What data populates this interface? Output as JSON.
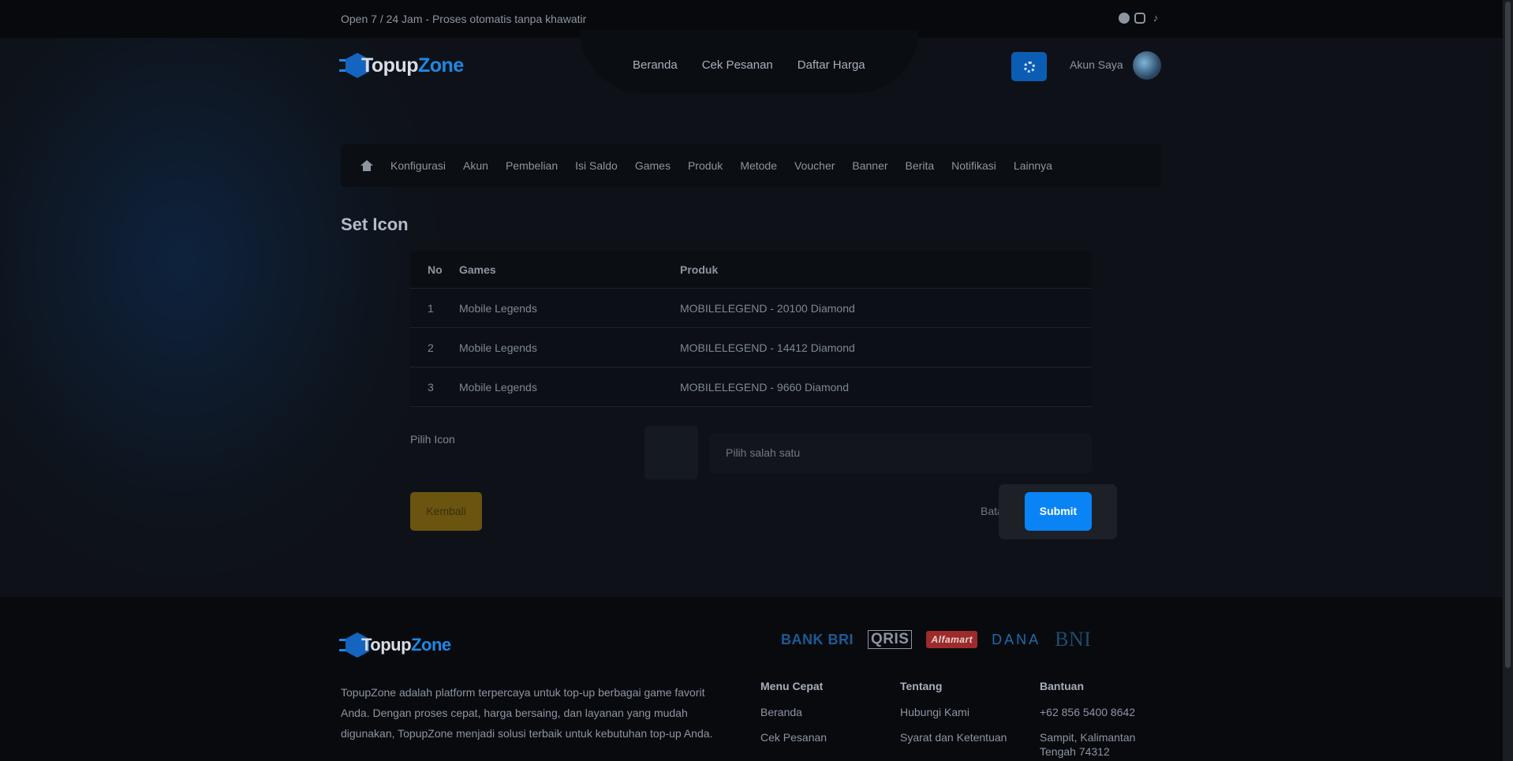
{
  "topbar": {
    "tagline": "Open 7 / 24 Jam - Proses otomatis tanpa khawatir",
    "socials": [
      "whatsapp-icon",
      "instagram-icon",
      "tiktok-icon"
    ]
  },
  "brand": {
    "name_part1": "Topup",
    "name_part2": "Zone"
  },
  "nav": {
    "home": "Beranda",
    "check_order": "Cek Pesanan",
    "price_list": "Daftar Harga"
  },
  "header": {
    "account_label": "Akun Saya"
  },
  "admin_menu": {
    "items": [
      "Konfigurasi",
      "Akun",
      "Pembelian",
      "Isi Saldo",
      "Games",
      "Produk",
      "Metode",
      "Voucher",
      "Banner",
      "Berita",
      "Notifikasi",
      "Lainnya"
    ]
  },
  "page_title": "Set Icon",
  "table": {
    "headers": {
      "no": "No",
      "games": "Games",
      "product": "Produk"
    },
    "rows": [
      {
        "no": "1",
        "game": "Mobile Legends",
        "product": "MOBILELEGEND - 20100 Diamond"
      },
      {
        "no": "2",
        "game": "Mobile Legends",
        "product": "MOBILELEGEND - 14412 Diamond"
      },
      {
        "no": "3",
        "game": "Mobile Legends",
        "product": "MOBILELEGEND - 9660 Diamond"
      }
    ]
  },
  "form": {
    "pick_icon_label": "Pilih Icon",
    "select_placeholder": "Pilih salah satu"
  },
  "buttons": {
    "back": "Kembali",
    "cancel": "Batal",
    "submit": "Submit"
  },
  "footer": {
    "description": "TopupZone adalah platform terpercaya untuk top-up berbagai game favorit Anda. Dengan proses cepat, harga bersaing, dan layanan yang mudah digunakan, TopupZone menjadi solusi terbaik untuk kebutuhan top-up Anda.",
    "payments": [
      "BANK BRI",
      "QRIS",
      "Alfamart",
      "DANA",
      "BNI"
    ],
    "columns": {
      "menu": {
        "title": "Menu Cepat",
        "items": [
          "Beranda",
          "Cek Pesanan"
        ]
      },
      "about": {
        "title": "Tentang",
        "items": [
          "Hubungi Kami",
          "Syarat dan Ketentuan"
        ]
      },
      "help": {
        "title": "Bantuan",
        "items": [
          "+62 856 5400 8642",
          "Sampit, Kalimantan Tengah 74312"
        ]
      }
    }
  },
  "colors": {
    "accent": "#0a84f5",
    "brand": "#1e88e5",
    "back_button": "#6a5410"
  }
}
